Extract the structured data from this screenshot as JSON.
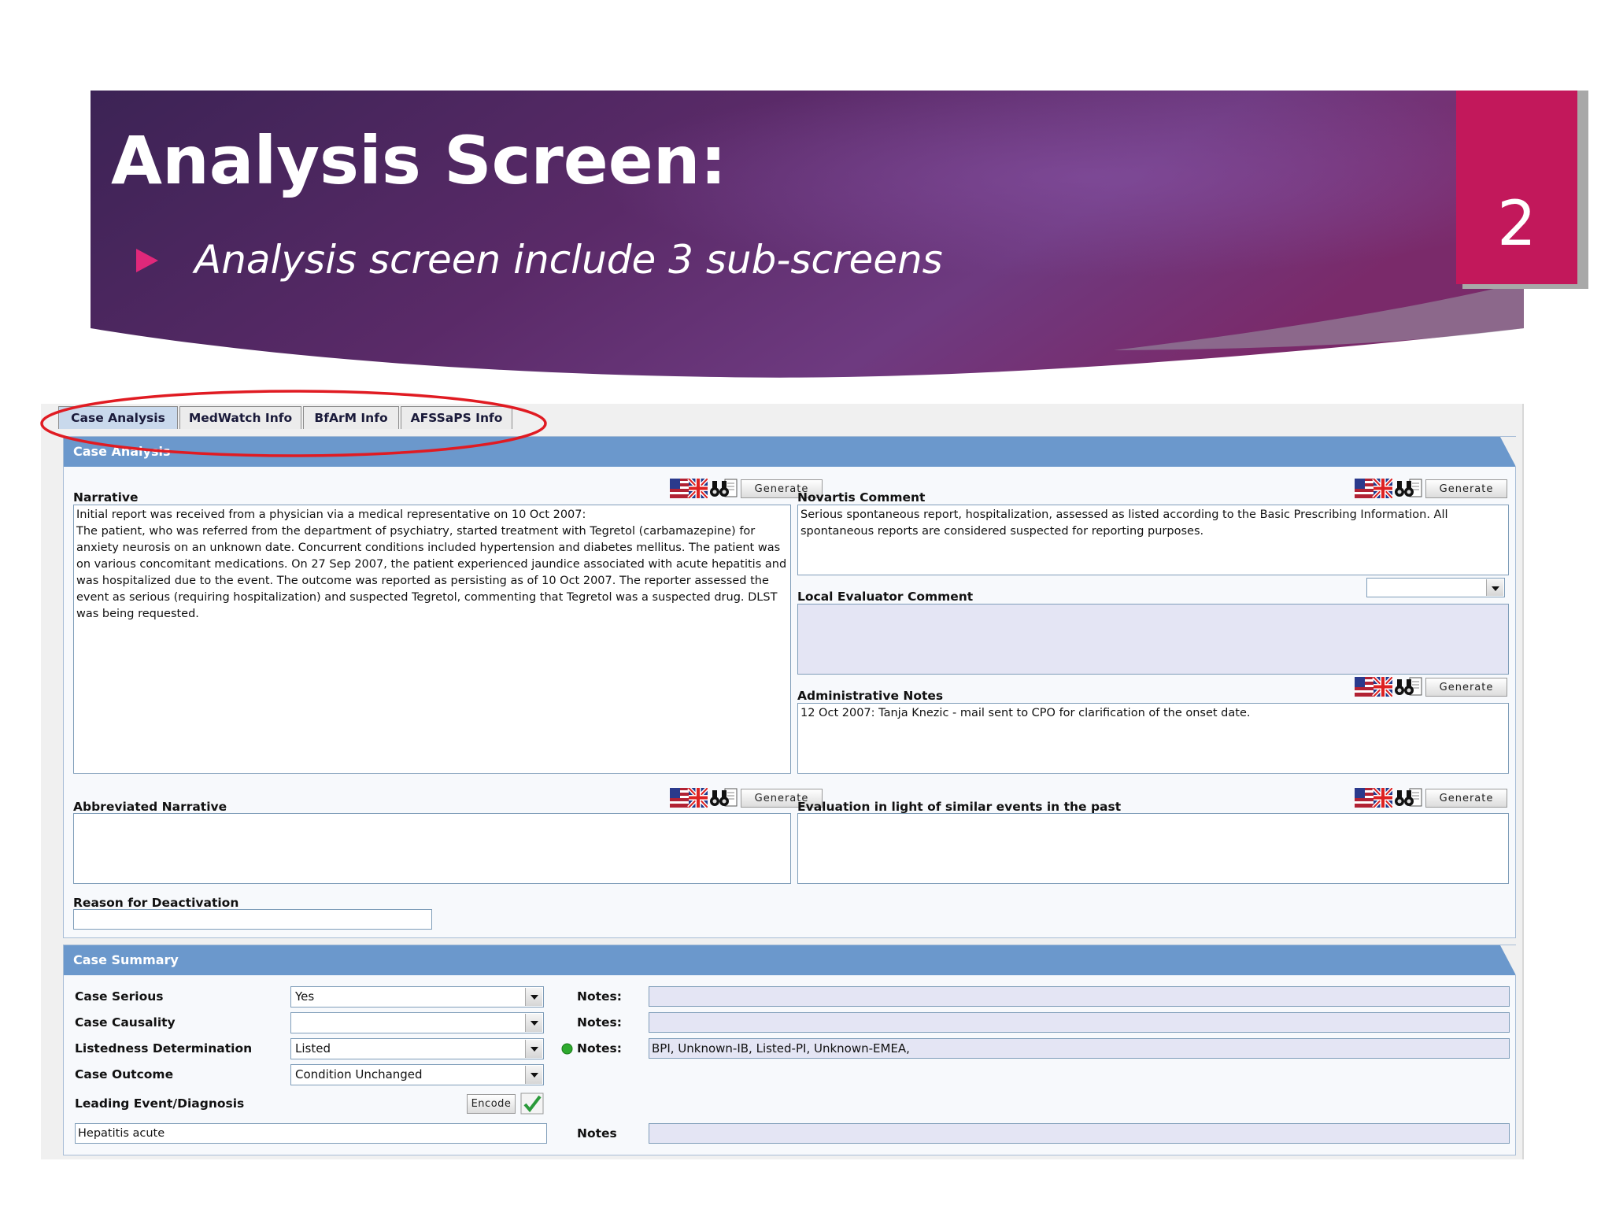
{
  "slide": {
    "title": "Analysis Screen:",
    "subtitle": "Analysis screen include 3 sub-screens",
    "number": "2"
  },
  "tabs": [
    {
      "label": "Case Analysis",
      "active": true
    },
    {
      "label": "MedWatch Info",
      "active": false
    },
    {
      "label": "BfArM Info",
      "active": false
    },
    {
      "label": "AFSSaPS Info",
      "active": false
    }
  ],
  "case_analysis": {
    "header": "Case Analysis",
    "generate_label": "Generate",
    "narrative": {
      "label": "Narrative",
      "text": "Initial report was received from a physician via a medical representative on 10 Oct 2007:\nThe patient, who was referred from the department of psychiatry, started treatment with Tegretol (carbamazepine) for anxiety neurosis on an unknown date. Concurrent conditions included hypertension and diabetes mellitus. The patient was on various concomitant medications. On 27 Sep 2007, the patient experienced jaundice associated with acute hepatitis and was hospitalized due to the event. The outcome was reported as persisting as of 10 Oct 2007. The reporter assessed the event as serious (requiring hospitalization) and suspected Tegretol, commenting that Tegretol was a suspected drug. DLST was being requested."
    },
    "novartis_comment": {
      "label": "Novartis Comment",
      "text": "Serious spontaneous report, hospitalization, assessed as listed according to the Basic Prescribing Information. All spontaneous reports are considered suspected for reporting purposes."
    },
    "local_evaluator_comment": {
      "label": "Local Evaluator Comment",
      "selected": "",
      "text": ""
    },
    "administrative_notes": {
      "label": "Administrative Notes",
      "text": "12 Oct 2007: Tanja Knezic - mail sent to CPO for clarification of the onset date."
    },
    "abbreviated_narrative": {
      "label": "Abbreviated Narrative",
      "text": ""
    },
    "evaluation": {
      "label": "Evaluation in light of similar events in the past",
      "text": ""
    },
    "reason_deactivation": {
      "label": "Reason for Deactivation",
      "value": ""
    }
  },
  "case_summary": {
    "header": "Case Summary",
    "rows": [
      {
        "label": "Case Serious",
        "value": "Yes",
        "notes_label": "Notes:",
        "notes": ""
      },
      {
        "label": "Case Causality",
        "value": "",
        "notes_label": "Notes:",
        "notes": ""
      },
      {
        "label": "Listedness Determination",
        "value": "Listed",
        "notes_label": "Notes:",
        "notes": "BPI,  Unknown-IB,  Listed-PI,  Unknown-EMEA,"
      },
      {
        "label": "Case Outcome",
        "value": "Condition Unchanged"
      }
    ],
    "leading_event": {
      "label": "Leading Event/Diagnosis",
      "encode_label": "Encode",
      "value": "Hepatitis acute",
      "notes_label": "Notes",
      "notes": ""
    }
  },
  "colors": {
    "header_gradient_start": "#3c2355",
    "header_gradient_end": "#7a2a6a",
    "slide_number_box": "#c2185b",
    "bullet": "#e0287a",
    "section_header": "#6b98cc",
    "tinted_field": "#e4e5f4",
    "highlight_ellipse": "#e01b22",
    "status_dot": "#2eaa2e"
  },
  "icons": [
    "flag-icon",
    "binoculars-icon",
    "chevron-down-icon",
    "checkmark-icon",
    "status-dot-icon",
    "bullet-arrow-icon"
  ]
}
